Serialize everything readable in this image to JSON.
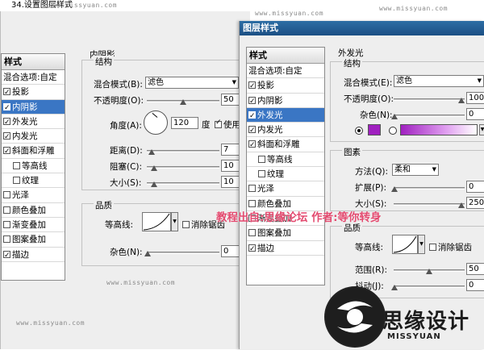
{
  "caption": "34.设置图层样式",
  "watermark": "www.missyuan.com",
  "back_dialog": {
    "panel_title": "样式",
    "blend_options": "混合选项:自定",
    "styles": [
      {
        "label": "投影",
        "checked": true,
        "selected": false,
        "sub": false
      },
      {
        "label": "内阴影",
        "checked": true,
        "selected": true,
        "sub": false
      },
      {
        "label": "外发光",
        "checked": true,
        "selected": false,
        "sub": false
      },
      {
        "label": "内发光",
        "checked": true,
        "selected": false,
        "sub": false
      },
      {
        "label": "斜面和浮雕",
        "checked": true,
        "selected": false,
        "sub": false
      },
      {
        "label": "等高线",
        "checked": false,
        "selected": false,
        "sub": true
      },
      {
        "label": "纹理",
        "checked": false,
        "selected": false,
        "sub": true
      },
      {
        "label": "光泽",
        "checked": false,
        "selected": false,
        "sub": false
      },
      {
        "label": "颜色叠加",
        "checked": false,
        "selected": false,
        "sub": false
      },
      {
        "label": "渐变叠加",
        "checked": false,
        "selected": false,
        "sub": false
      },
      {
        "label": "图案叠加",
        "checked": false,
        "selected": false,
        "sub": false
      },
      {
        "label": "描边",
        "checked": true,
        "selected": false,
        "sub": false
      }
    ],
    "section_title": "内阴影",
    "structure_title": "结构",
    "blend_mode_label": "混合模式(B):",
    "blend_mode_value": "滤色",
    "opacity_label": "不透明度(O):",
    "opacity_value": "50",
    "angle_label": "角度(A):",
    "angle_value": "120",
    "angle_unit": "度",
    "global_light": "使用",
    "distance_label": "距离(D):",
    "distance_value": "7",
    "choke_label": "阻塞(C):",
    "choke_value": "10",
    "size_label": "大小(S):",
    "size_value": "10",
    "quality_title": "品质",
    "contour_label": "等高线:",
    "antialias_label": "消除锯齿",
    "noise_label": "杂色(N):",
    "noise_value": "0"
  },
  "front_dialog": {
    "title": "图层样式",
    "panel_title": "样式",
    "blend_options": "混合选项:自定",
    "styles": [
      {
        "label": "投影",
        "checked": true,
        "selected": false,
        "sub": false
      },
      {
        "label": "内阴影",
        "checked": true,
        "selected": false,
        "sub": false
      },
      {
        "label": "外发光",
        "checked": true,
        "selected": true,
        "sub": false
      },
      {
        "label": "内发光",
        "checked": true,
        "selected": false,
        "sub": false
      },
      {
        "label": "斜面和浮雕",
        "checked": true,
        "selected": false,
        "sub": false
      },
      {
        "label": "等高线",
        "checked": false,
        "selected": false,
        "sub": true
      },
      {
        "label": "纹理",
        "checked": false,
        "selected": false,
        "sub": true
      },
      {
        "label": "光泽",
        "checked": false,
        "selected": false,
        "sub": false
      },
      {
        "label": "颜色叠加",
        "checked": false,
        "selected": false,
        "sub": false
      },
      {
        "label": "渐变叠加",
        "checked": false,
        "selected": false,
        "sub": false
      },
      {
        "label": "图案叠加",
        "checked": false,
        "selected": false,
        "sub": false
      },
      {
        "label": "描边",
        "checked": true,
        "selected": false,
        "sub": false
      }
    ],
    "section_title": "外发光",
    "structure_title": "结构",
    "blend_mode_label": "混合模式(E):",
    "blend_mode_value": "滤色",
    "opacity_label": "不透明度(O):",
    "opacity_value": "100",
    "noise_label": "杂色(N):",
    "noise_value": "0",
    "glow_color": "#a020c0",
    "elements_title": "图素",
    "method_label": "方法(Q):",
    "method_value": "柔和",
    "spread_label": "扩展(P):",
    "spread_value": "0",
    "size_label": "大小(S):",
    "size_value": "250",
    "quality_title": "品质",
    "contour_label": "等高线:",
    "antialias_label": "消除锯齿",
    "range_label": "范围(R):",
    "range_value": "50",
    "jitter_label": "抖动(J):",
    "jitter_value": "0"
  },
  "note_text": "教程出自:思缘论坛      作者:等你转身",
  "logo": {
    "name": "思缘设计",
    "sub": "MISSYUAN"
  }
}
